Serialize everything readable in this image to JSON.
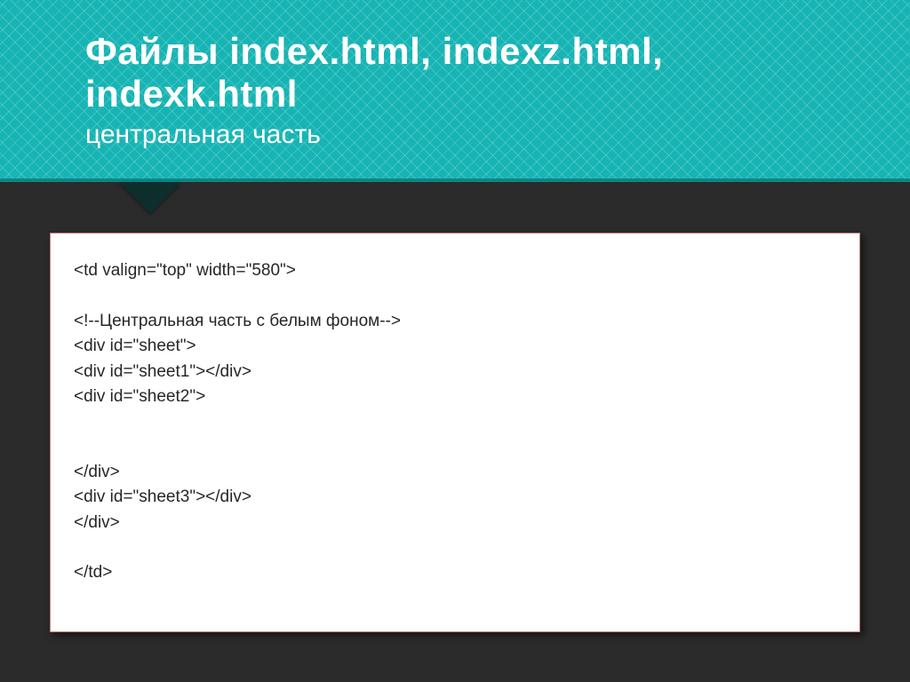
{
  "header": {
    "title_line1": "Файлы index.html, indexz.html,",
    "title_line2": "indexk.html",
    "subtitle": "центральная часть"
  },
  "code": {
    "l1": "<td valign=\"top\" width=\"580\">",
    "l2": "<!--Центральная часть с белым фоном-->",
    "l3": "<div id=\"sheet\">",
    "l4": "<div id=\"sheet1\"></div>",
    "l5": "<div id=\"sheet2\">",
    "l6": "</div>",
    "l7": "<div id=\"sheet3\"></div>",
    "l8": "</div>",
    "l9": "</td>"
  }
}
